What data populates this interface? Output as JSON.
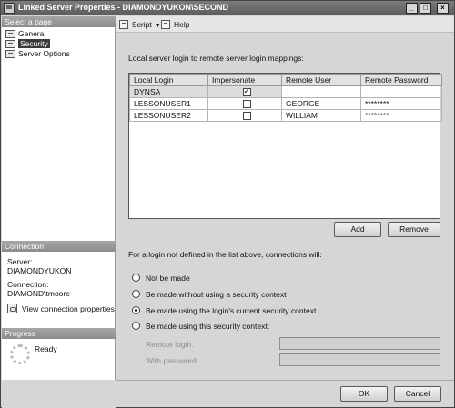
{
  "window": {
    "title": "Linked Server Properties - DIAMONDYUKON\\SECOND",
    "minimize_glyph": "_",
    "maximize_glyph": "□",
    "close_glyph": "×"
  },
  "sidebar": {
    "select_page_header": "Select a page",
    "pages": [
      {
        "label": "General",
        "icon": "page-icon"
      },
      {
        "label": "Security",
        "icon": "page-icon",
        "selected": true
      },
      {
        "label": "Server Options",
        "icon": "page-icon"
      }
    ],
    "connection_header": "Connection",
    "server_label": "Server:",
    "server_value": "DIAMONDYUKON",
    "connection_label": "Connection:",
    "connection_value": "DIAMOND\\tmoore",
    "view_link": "View connection properties",
    "progress_header": "Progress",
    "progress_status": "Ready"
  },
  "toolbar": {
    "script_label": "Script",
    "help_label": "Help"
  },
  "mappings": {
    "caption": "Local server login to remote server login mappings:",
    "columns": [
      "Local Login",
      "Impersonate",
      "Remote User",
      "Remote Password"
    ],
    "rows": [
      {
        "local_login": "DYNSA",
        "impersonate": true,
        "remote_user": "",
        "remote_password": ""
      },
      {
        "local_login": "LESSONUSER1",
        "impersonate": false,
        "remote_user": "GEORGE",
        "remote_password": "********"
      },
      {
        "local_login": "LESSONUSER2",
        "impersonate": false,
        "remote_user": "WILLIAM",
        "remote_password": "********"
      }
    ],
    "add_label": "Add",
    "remove_label": "Remove"
  },
  "not_defined": {
    "caption": "For a login not defined in the list above, connections will:",
    "options": [
      {
        "label": "Not be made",
        "checked": false
      },
      {
        "label": "Be made without using a security context",
        "checked": false
      },
      {
        "label": "Be made using the login's current security context",
        "checked": true
      },
      {
        "label": "Be made using this security context:",
        "checked": false
      }
    ],
    "remote_login_label": "Remote login:",
    "remote_login_value": "",
    "password_label": "With password:",
    "password_value": ""
  },
  "footer": {
    "ok_label": "OK",
    "cancel_label": "Cancel"
  }
}
